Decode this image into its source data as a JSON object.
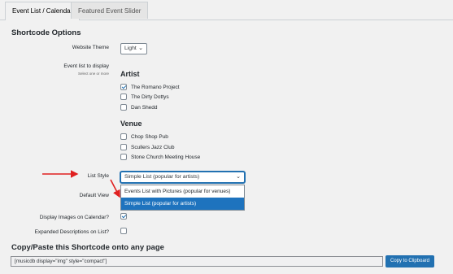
{
  "tabs": [
    {
      "label": "Event List / Calendar",
      "active": true
    },
    {
      "label": "Featured Event Slider",
      "active": false
    }
  ],
  "section_title": "Shortcode Options",
  "website_theme": {
    "label": "Website Theme",
    "value": "Light"
  },
  "event_list": {
    "label": "Event list to display",
    "sublabel": "Select one or more",
    "groups": [
      {
        "title": "Artist",
        "items": [
          {
            "label": "The Romano Project",
            "checked": true
          },
          {
            "label": "The Dirty Dottys",
            "checked": false
          },
          {
            "label": "Dan Shedd",
            "checked": false
          }
        ]
      },
      {
        "title": "Venue",
        "items": [
          {
            "label": "Chop Shop Pub",
            "checked": false
          },
          {
            "label": "Scullers Jazz Club",
            "checked": false
          },
          {
            "label": "Stone Church Meeting House",
            "checked": false
          }
        ]
      }
    ]
  },
  "list_style": {
    "label": "List Style",
    "value": "Simple List (popular for artists)",
    "options": [
      "Events List with Pictures (popular for venues)",
      "Simple List (popular for artists)"
    ],
    "selected_index": 1
  },
  "default_view": {
    "label": "Default View"
  },
  "display_images": {
    "label": "Display Images on Calendar?",
    "checked": true
  },
  "expanded_descriptions": {
    "label": "Expanded Descriptions on List?",
    "checked": false
  },
  "copy_section": {
    "title": "Copy/Paste this Shortcode onto any page",
    "shortcode": "[musicdb display=\"img\" style=\"compact\"]",
    "button_label": "Copy to Clipboard"
  },
  "colors": {
    "accent": "#2271b1",
    "arrow": "#e02020",
    "selected_option": "#1e73be"
  }
}
